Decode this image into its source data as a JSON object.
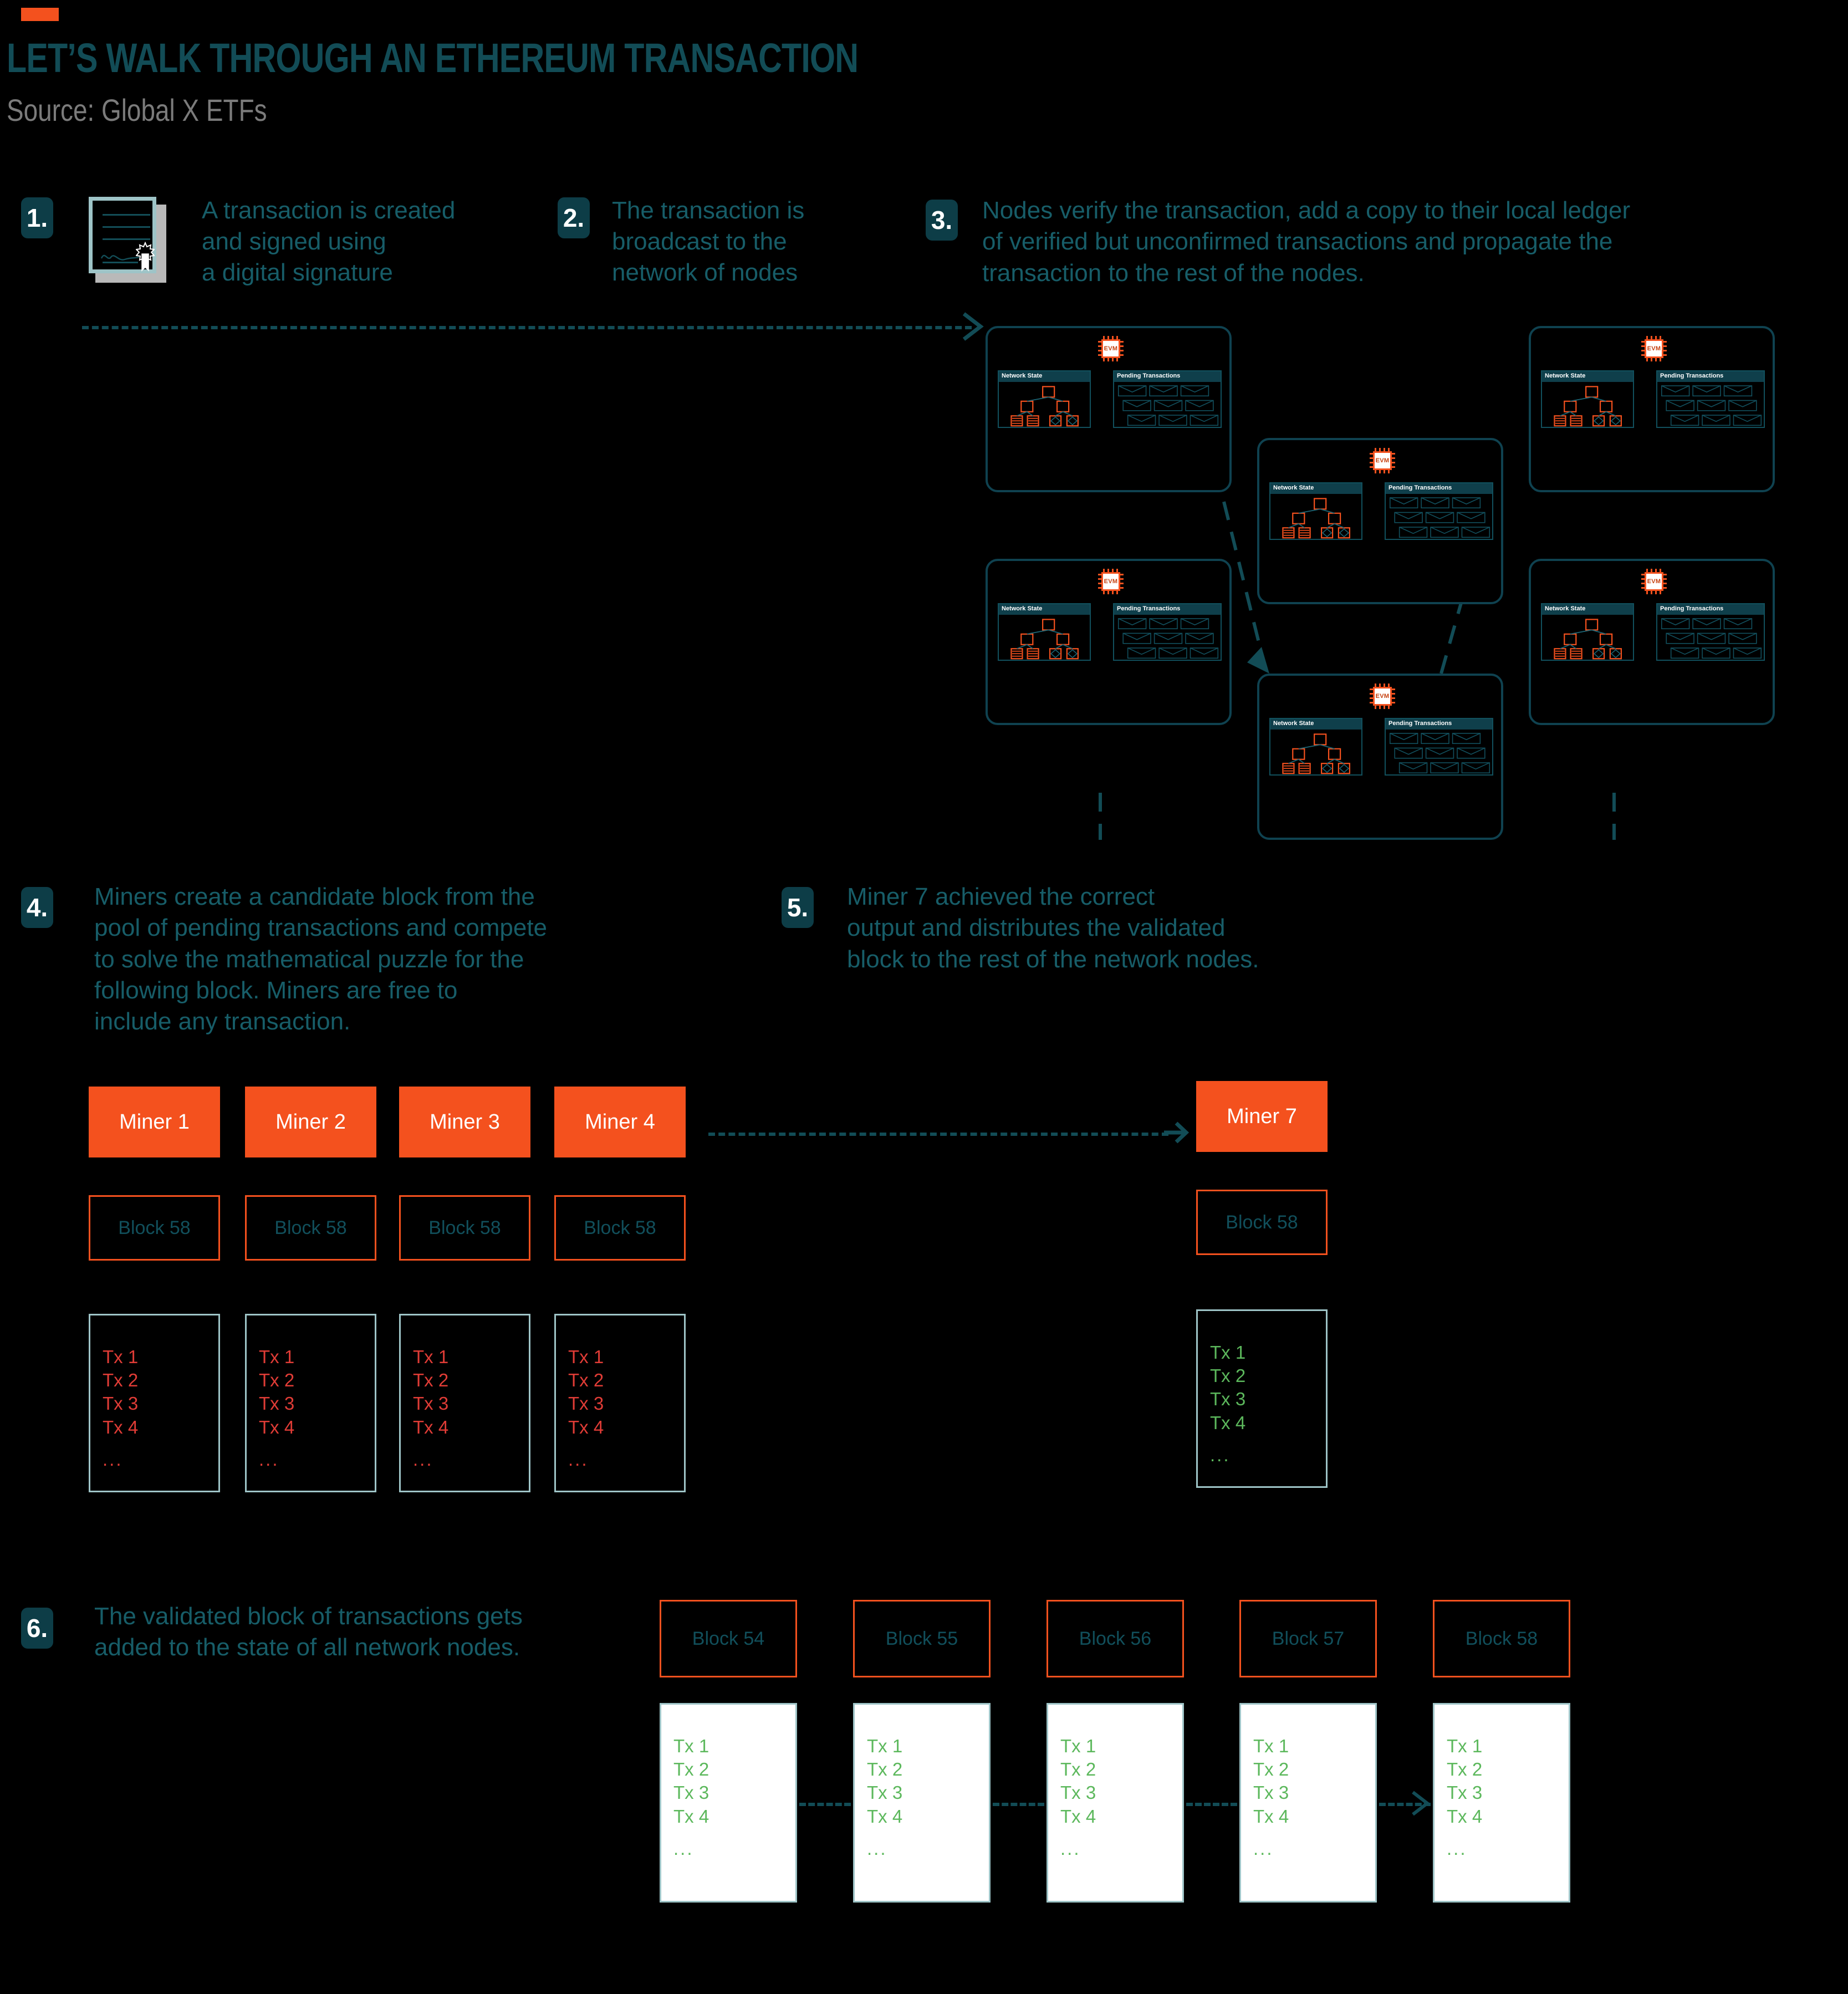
{
  "header": {
    "title": "LET’S WALK THROUGH AN ETHEREUM TRANSACTION",
    "source": "Source: Global X ETFs",
    "accent_color": "#f4511e",
    "title_color": "#124c56",
    "source_color": "#7b7b7b"
  },
  "steps": [
    {
      "number": "1.",
      "text": "A transaction is created\nand signed using\na digital signature"
    },
    {
      "number": "2.",
      "text": "The transaction is\nbroadcast to the\nnetwork of nodes"
    },
    {
      "number": "3.",
      "text": "Nodes verify the transaction, add a copy to their local ledger\nof verified but unconfirmed transactions and propagate the\ntransaction to the rest of the nodes."
    },
    {
      "number": "4.",
      "text": "Miners create a candidate block from the\npool of pending transactions and compete\nto solve the mathematical puzzle for the\nfollowing block. Miners are free to\ninclude any transaction."
    },
    {
      "number": "5.",
      "text": "Miner 7 achieved the correct\noutput and distributes the validated\nblock to the rest of the network nodes."
    },
    {
      "number": "6.",
      "text": "The validated block of transactions gets\nadded to the state of all network nodes."
    }
  ],
  "node_diagram": {
    "chip_label": "EVM",
    "panel_network_state": "Network State",
    "panel_pending_transactions": "Pending Transactions",
    "node_count": 6,
    "envelope_count_per_node": 9,
    "border_color": "#0f4250",
    "chip_color": "#f4511e",
    "tree_node_color": "#f4511e"
  },
  "miners": {
    "competing": [
      {
        "name": "Miner 1",
        "block": "Block 58",
        "txs": [
          "Tx 1",
          "Tx 2",
          "Tx 3",
          "Tx 4"
        ],
        "ellipsis": "...",
        "tx_color": "#e03c36"
      },
      {
        "name": "Miner 2",
        "block": "Block 58",
        "txs": [
          "Tx 1",
          "Tx 2",
          "Tx 3",
          "Tx 4"
        ],
        "ellipsis": "...",
        "tx_color": "#e03c36"
      },
      {
        "name": "Miner 3",
        "block": "Block 58",
        "txs": [
          "Tx 1",
          "Tx 2",
          "Tx 3",
          "Tx 4"
        ],
        "ellipsis": "...",
        "tx_color": "#e03c36"
      },
      {
        "name": "Miner 4",
        "block": "Block 58",
        "txs": [
          "Tx 1",
          "Tx 2",
          "Tx 3",
          "Tx 4"
        ],
        "ellipsis": "...",
        "tx_color": "#e03c36"
      }
    ],
    "winner": {
      "name": "Miner 7",
      "block": "Block 58",
      "txs": [
        "Tx 1",
        "Tx 2",
        "Tx 3",
        "Tx 4"
      ],
      "ellipsis": "...",
      "tx_color": "#5cb85c"
    }
  },
  "chain": [
    {
      "block": "Block 54",
      "txs": [
        "Tx 1",
        "Tx 2",
        "Tx 3",
        "Tx 4"
      ],
      "ellipsis": "..."
    },
    {
      "block": "Block 55",
      "txs": [
        "Tx 1",
        "Tx 2",
        "Tx 3",
        "Tx 4"
      ],
      "ellipsis": "..."
    },
    {
      "block": "Block 56",
      "txs": [
        "Tx 1",
        "Tx 2",
        "Tx 3",
        "Tx 4"
      ],
      "ellipsis": "..."
    },
    {
      "block": "Block 57",
      "txs": [
        "Tx 1",
        "Tx 2",
        "Tx 3",
        "Tx 4"
      ],
      "ellipsis": "..."
    },
    {
      "block": "Block 58",
      "txs": [
        "Tx 1",
        "Tx 2",
        "Tx 3",
        "Tx 4"
      ],
      "ellipsis": "..."
    }
  ],
  "palette": {
    "background": "#000000",
    "teal": "#124c56",
    "orange": "#f4511e",
    "light_blue_grey": "#9ec4c7",
    "red": "#e03c36",
    "green": "#5cb85c"
  }
}
